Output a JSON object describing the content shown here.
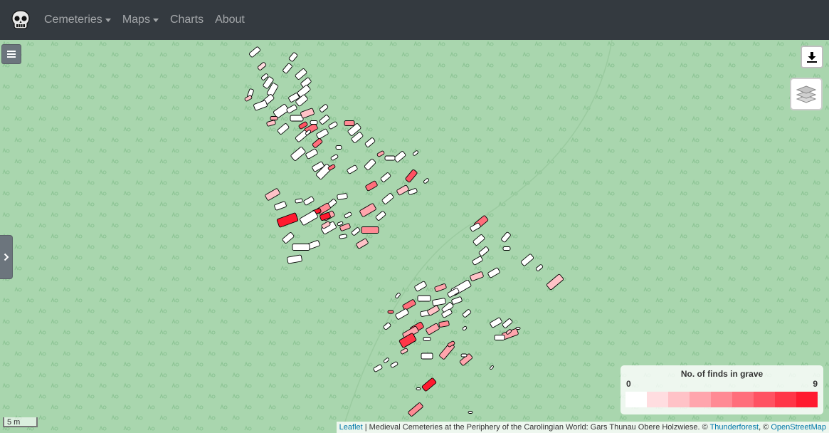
{
  "navbar": {
    "logo_icon": "skull-icon",
    "items": [
      {
        "label": "Cemeteries",
        "dropdown": true
      },
      {
        "label": "Maps",
        "dropdown": true
      },
      {
        "label": "Charts",
        "dropdown": false
      },
      {
        "label": "About",
        "dropdown": false
      }
    ]
  },
  "map": {
    "basemap": "Thunderforest landscape (grassland pattern)",
    "controls": {
      "menu_icon": "hamburger-icon",
      "sidebar_toggle_icon": "chevron-right-icon",
      "download_icon": "download-icon",
      "layers_icon": "layers-icon"
    },
    "legend": {
      "title": "No. of finds in grave",
      "min_label": "0",
      "max_label": "9",
      "colors": [
        "#ffffff",
        "#ffdde0",
        "#ffc2c7",
        "#ffa5ad",
        "#ff8a94",
        "#ff6e7b",
        "#ff5262",
        "#ff3648",
        "#ff1a2f"
      ]
    },
    "scale_label": "5 m",
    "attribution": {
      "leaflet_link": "Leaflet",
      "text": " | Medieval Cemeteries at the Periphery of the Carolingian World: Gars Thunau Obere Holzwiese. © ",
      "thunderforest_link": "Thunderforest",
      "separator": ", © ",
      "osm_link": "OpenStreetMap"
    }
  }
}
